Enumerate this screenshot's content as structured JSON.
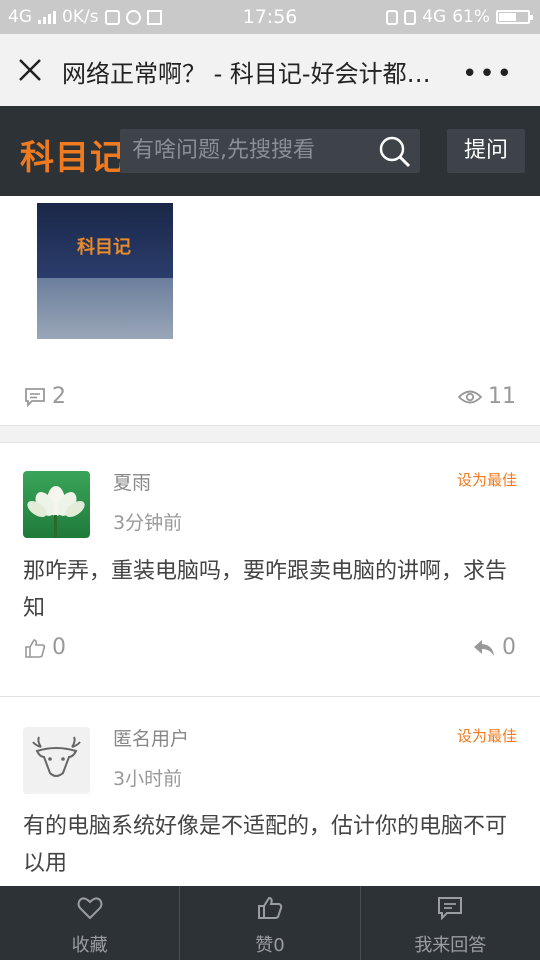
{
  "status_bar": {
    "network": "4G",
    "speed": "0K/s",
    "time": "17:56",
    "net_right": "4G",
    "battery_pct": "61%",
    "battery_level": 0.61
  },
  "titlebar": {
    "title": "网络正常啊？ - 科目记-好会计都…",
    "more": "•••"
  },
  "header": {
    "logo": "科目记",
    "search_placeholder": "有啥问题,先搜搜看",
    "ask_label": "提问"
  },
  "question": {
    "image_logo": "科目记",
    "comment_count": "2",
    "view_count": "11"
  },
  "answers": [
    {
      "user": "夏雨",
      "time": "3分钟前",
      "best_label": "设为最佳",
      "text": "那咋弄，重装电脑吗，要咋跟卖电脑的讲啊，求告知",
      "likes": "0",
      "replies": "0"
    },
    {
      "user": "匿名用户",
      "time": "3小时前",
      "best_label": "设为最佳",
      "text": "有的电脑系统好像是不适配的，估计你的电脑不可以用"
    }
  ],
  "bottom_bar": {
    "favorite_label": "收藏",
    "like_label": "赞0",
    "answer_label": "我来回答"
  }
}
